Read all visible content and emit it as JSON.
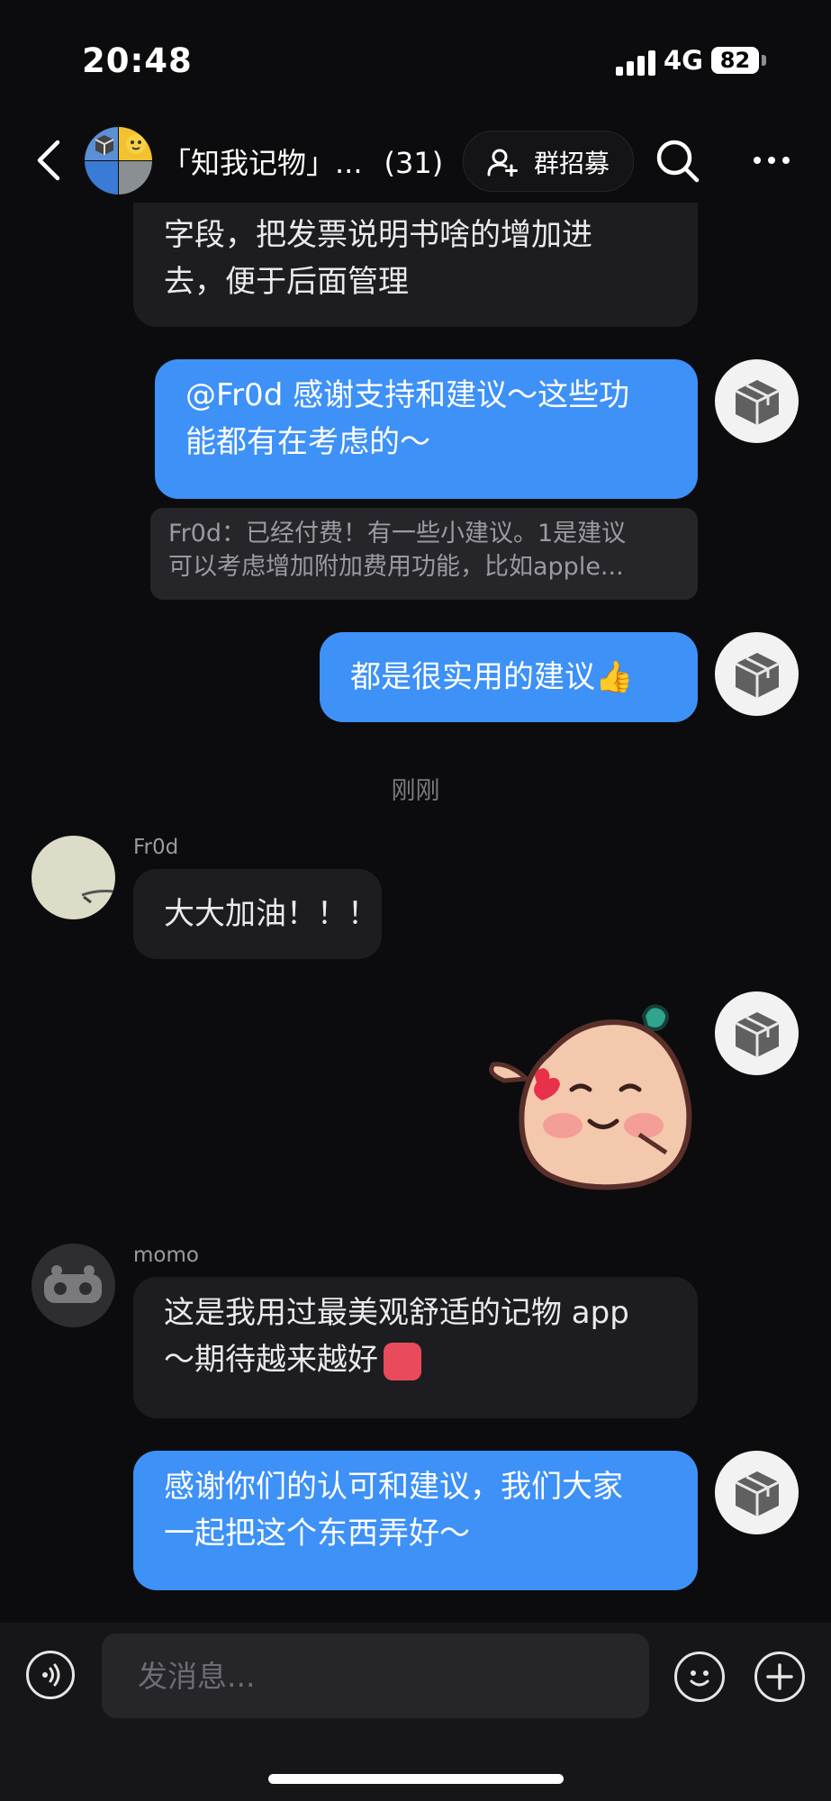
{
  "status_bar": {
    "time": "20:48",
    "network": "4G",
    "battery": "82"
  },
  "header": {
    "title": "「知我记物」...",
    "member_count": "(31)",
    "recruit_label": "群招募",
    "icons": [
      "back-icon",
      "search-icon",
      "more-icon",
      "add-user-icon"
    ]
  },
  "messages": {
    "m0_line1": "字段，把发票说明书啥的增加进",
    "m0_line2": "去，便于后面管理",
    "m1_line1": "@Fr0d 感谢支持和建议～这些功",
    "m1_line2": "能都有在考虑的～",
    "quote_line1": "Fr0d：已经付费！有一些小建议。1是建议",
    "quote_line2": "可以考虑增加附加费用功能，比如apple...",
    "m2": "都是很实用的建议👍",
    "timestamp": "刚刚",
    "frod_name": "Fr0d",
    "m3": "大大加油！！！",
    "momo_name": "momo",
    "m5_line1": "这是我用过最美观舒适的记物 app",
    "m5_line2": "～期待越来越好",
    "m6_line1": "感谢你们的认可和建议，我们大家",
    "m6_line2": "一起把这个东西弄好～"
  },
  "input": {
    "placeholder": "发消息..."
  },
  "colors": {
    "accent_blue": "#3d91f7",
    "background": "#0c0c0e",
    "bubble_gray": "#1d1d21"
  }
}
